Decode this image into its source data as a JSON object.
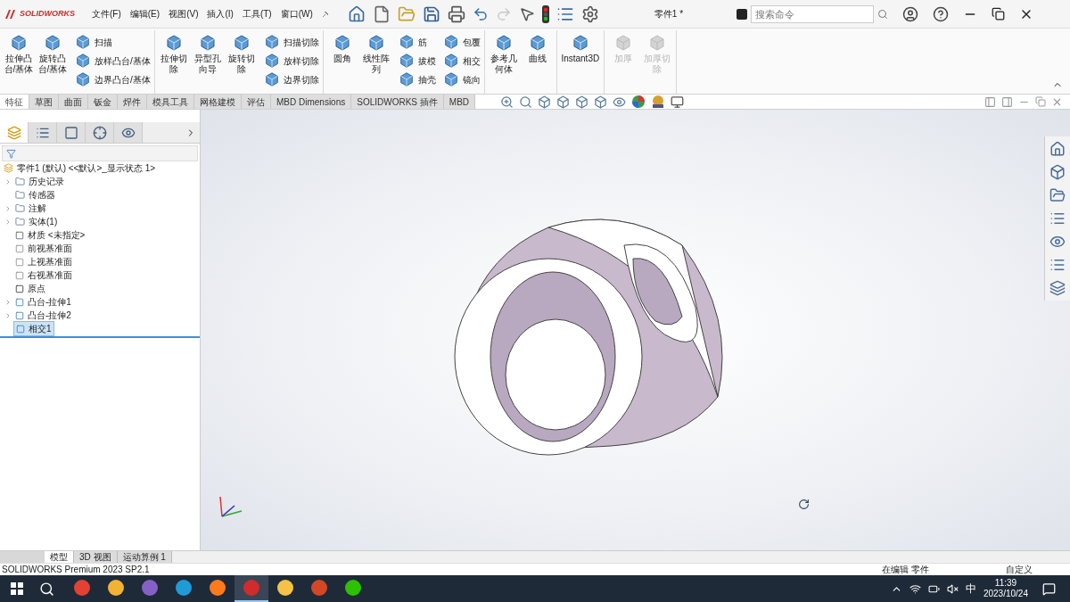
{
  "app": {
    "logo": "SOLIDWORKS",
    "menu": [
      "文件(F)",
      "编辑(E)",
      "视图(V)",
      "插入(I)",
      "工具(T)",
      "窗口(W)"
    ],
    "title": "零件1 *",
    "search": {
      "placeholder": "搜索命令"
    }
  },
  "ribbon": {
    "groups": [
      {
        "disabled": false,
        "items": [
          {
            "kind": "large",
            "label": "拉伸凸台/基体"
          },
          {
            "kind": "large",
            "label": "旋转凸台/基体"
          },
          {
            "kind": "small",
            "label": "扫描"
          },
          {
            "kind": "small",
            "label": "放样凸台/基体"
          },
          {
            "kind": "small",
            "label": "边界凸台/基体"
          }
        ]
      },
      {
        "disabled": false,
        "items": [
          {
            "kind": "large",
            "label": "拉伸切除"
          },
          {
            "kind": "large",
            "label": "异型孔向导"
          },
          {
            "kind": "large",
            "label": "旋转切除"
          },
          {
            "kind": "small",
            "label": "扫描切除"
          },
          {
            "kind": "small",
            "label": "放样切除"
          },
          {
            "kind": "small",
            "label": "边界切除"
          }
        ]
      },
      {
        "disabled": false,
        "items": [
          {
            "kind": "large",
            "label": "圆角"
          },
          {
            "kind": "large",
            "label": "线性阵列"
          },
          {
            "kind": "small",
            "label": "筋"
          },
          {
            "kind": "small",
            "label": "拔模"
          },
          {
            "kind": "small",
            "label": "抽壳"
          },
          {
            "kind": "small",
            "label": "包覆"
          },
          {
            "kind": "small",
            "label": "相交"
          },
          {
            "kind": "small",
            "label": "镜向"
          }
        ]
      },
      {
        "disabled": false,
        "items": [
          {
            "kind": "large",
            "label": "参考几何体"
          },
          {
            "kind": "large",
            "label": "曲线"
          }
        ]
      },
      {
        "disabled": false,
        "items": [
          {
            "kind": "wide",
            "label": "Instant3D"
          }
        ]
      },
      {
        "disabled": true,
        "items": [
          {
            "kind": "large",
            "label": "加厚"
          },
          {
            "kind": "large",
            "label": "加厚切除"
          }
        ]
      }
    ]
  },
  "tabs": [
    {
      "label": "特征",
      "selected": true
    },
    {
      "label": "草图",
      "selected": false
    },
    {
      "label": "曲面",
      "selected": false
    },
    {
      "label": "钣金",
      "selected": false
    },
    {
      "label": "焊件",
      "selected": false
    },
    {
      "label": "模具工具",
      "selected": false
    },
    {
      "label": "网格建模",
      "selected": false
    },
    {
      "label": "评估",
      "selected": false
    },
    {
      "label": "MBD Dimensions",
      "selected": false
    },
    {
      "label": "SOLIDWORKS 插件",
      "selected": false
    },
    {
      "label": "MBD",
      "selected": false
    }
  ],
  "panel_tabs": [
    {
      "kind": "feature",
      "selected": true
    },
    {
      "kind": "property",
      "selected": false
    },
    {
      "kind": "config",
      "selected": false
    },
    {
      "kind": "dimxpert",
      "selected": false
    },
    {
      "kind": "display",
      "selected": false
    }
  ],
  "tree": {
    "root": "零件1 (默认) <<默认>_显示状态 1>",
    "items": [
      {
        "kind": "folder",
        "label": "历史记录",
        "has_children": true,
        "selected": false
      },
      {
        "kind": "folder",
        "label": "传感器",
        "has_children": false,
        "selected": false
      },
      {
        "kind": "folder",
        "label": "注解",
        "has_children": true,
        "selected": false
      },
      {
        "kind": "folder",
        "label": "实体(1)",
        "has_children": true,
        "selected": false
      },
      {
        "kind": "material",
        "label": "材质 <未指定>",
        "has_children": false,
        "selected": false
      },
      {
        "kind": "plane",
        "label": "前视基准面",
        "has_children": false,
        "selected": false
      },
      {
        "kind": "plane",
        "label": "上视基准面",
        "has_children": false,
        "selected": false
      },
      {
        "kind": "plane",
        "label": "右视基准面",
        "has_children": false,
        "selected": false
      },
      {
        "kind": "origin",
        "label": "原点",
        "has_children": false,
        "selected": false
      },
      {
        "kind": "feature",
        "label": "凸台-拉伸1",
        "has_children": true,
        "selected": false
      },
      {
        "kind": "feature",
        "label": "凸台-拉伸2",
        "has_children": true,
        "selected": false
      },
      {
        "kind": "intersect",
        "label": "相交1",
        "has_children": false,
        "selected": true
      }
    ]
  },
  "bottom_tabs": [
    {
      "label": "模型",
      "selected": true
    },
    {
      "label": "3D 视图",
      "selected": false
    },
    {
      "label": "运动算例 1",
      "selected": false
    }
  ],
  "status_bar": {
    "product": "SOLIDWORKS Premium 2023 SP2.1",
    "mode": "在编辑 零件",
    "units": "自定义"
  },
  "taskbar": {
    "apps": [
      {
        "kind": "chrome",
        "selected": false
      },
      {
        "kind": "chrome-alt",
        "selected": false
      },
      {
        "kind": "studio",
        "selected": false
      },
      {
        "kind": "edge",
        "selected": false
      },
      {
        "kind": "firefox",
        "selected": false
      },
      {
        "kind": "solidworks",
        "selected": true
      },
      {
        "kind": "explorer",
        "selected": false
      },
      {
        "kind": "powerpoint",
        "selected": false
      },
      {
        "kind": "wechat",
        "selected": false
      }
    ],
    "ime": "中",
    "time": "11:39",
    "date": "2023/10/24"
  }
}
